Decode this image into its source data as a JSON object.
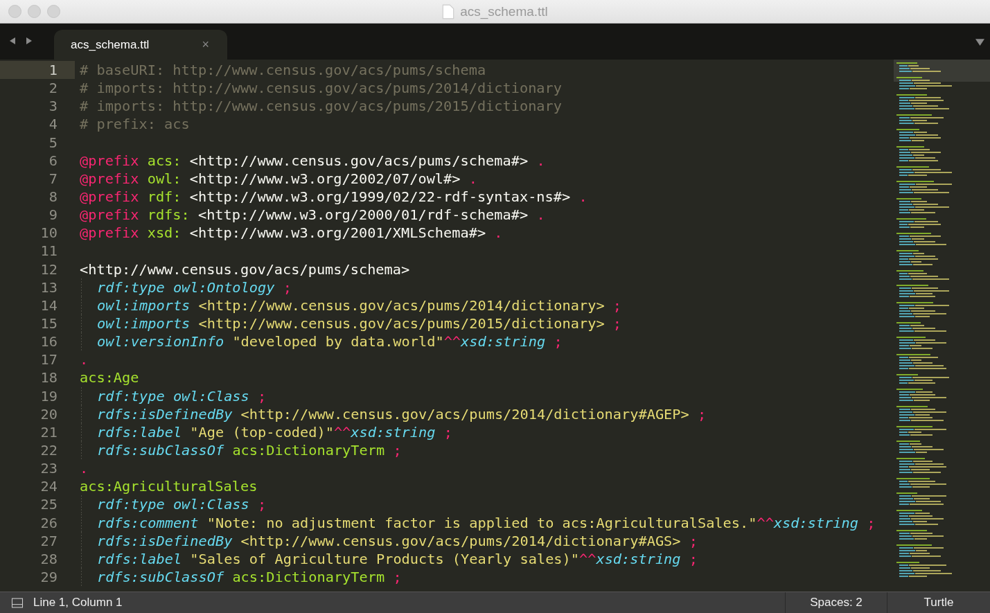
{
  "window": {
    "title": "acs_schema.ttl"
  },
  "tabs": [
    {
      "label": "acs_schema.ttl",
      "selected": true,
      "close": "×"
    }
  ],
  "lines": [
    {
      "number": "1",
      "current": true,
      "indented": false,
      "tokens": [
        {
          "kind": "comment",
          "text": "# baseURI: http://www.census.gov/acs/pums/schema"
        }
      ]
    },
    {
      "number": "2",
      "current": false,
      "indented": false,
      "tokens": [
        {
          "kind": "comment",
          "text": "# imports: http://www.census.gov/acs/pums/2014/dictionary"
        }
      ]
    },
    {
      "number": "3",
      "current": false,
      "indented": false,
      "tokens": [
        {
          "kind": "comment",
          "text": "# imports: http://www.census.gov/acs/pums/2015/dictionary"
        }
      ]
    },
    {
      "number": "4",
      "current": false,
      "indented": false,
      "tokens": [
        {
          "kind": "comment",
          "text": "# prefix: acs"
        }
      ]
    },
    {
      "number": "5",
      "current": false
    },
    {
      "number": "6",
      "current": false,
      "indented": false,
      "tokens": [
        {
          "kind": "keyword",
          "text": "@prefix "
        },
        {
          "kind": "name",
          "text": "acs: "
        },
        {
          "kind": "plain",
          "text": "<http://www.census.gov/acs/pums/schema#> "
        },
        {
          "kind": "keyword",
          "text": "."
        }
      ]
    },
    {
      "number": "7",
      "current": false,
      "indented": false,
      "tokens": [
        {
          "kind": "keyword",
          "text": "@prefix "
        },
        {
          "kind": "name",
          "text": "owl: "
        },
        {
          "kind": "plain",
          "text": "<http://www.w3.org/2002/07/owl#> "
        },
        {
          "kind": "keyword",
          "text": "."
        }
      ]
    },
    {
      "number": "8",
      "current": false,
      "indented": false,
      "tokens": [
        {
          "kind": "keyword",
          "text": "@prefix "
        },
        {
          "kind": "name",
          "text": "rdf: "
        },
        {
          "kind": "plain",
          "text": "<http://www.w3.org/1999/02/22-rdf-syntax-ns#> "
        },
        {
          "kind": "keyword",
          "text": "."
        }
      ]
    },
    {
      "number": "9",
      "current": false,
      "indented": false,
      "tokens": [
        {
          "kind": "keyword",
          "text": "@prefix "
        },
        {
          "kind": "name",
          "text": "rdfs: "
        },
        {
          "kind": "plain",
          "text": "<http://www.w3.org/2000/01/rdf-schema#> "
        },
        {
          "kind": "keyword",
          "text": "."
        }
      ]
    },
    {
      "number": "10",
      "current": false,
      "indented": false,
      "tokens": [
        {
          "kind": "keyword",
          "text": "@prefix "
        },
        {
          "kind": "name",
          "text": "xsd: "
        },
        {
          "kind": "plain",
          "text": "<http://www.w3.org/2001/XMLSchema#> "
        },
        {
          "kind": "keyword",
          "text": "."
        }
      ]
    },
    {
      "number": "11",
      "current": false
    },
    {
      "number": "12",
      "current": false,
      "indented": false,
      "tokens": [
        {
          "kind": "plain",
          "text": "<http://www.census.gov/acs/pums/schema>"
        }
      ]
    },
    {
      "number": "13",
      "current": false,
      "indented": true,
      "tokens": [
        {
          "kind": "type",
          "text": "rdf:type owl:Ontology "
        },
        {
          "kind": "keyword",
          "text": ";"
        }
      ]
    },
    {
      "number": "14",
      "current": false,
      "indented": true,
      "tokens": [
        {
          "kind": "type",
          "text": "owl:imports "
        },
        {
          "kind": "string",
          "text": "<http://www.census.gov/acs/pums/2014/dictionary> "
        },
        {
          "kind": "keyword",
          "text": ";"
        }
      ]
    },
    {
      "number": "15",
      "current": false,
      "indented": true,
      "tokens": [
        {
          "kind": "type",
          "text": "owl:imports "
        },
        {
          "kind": "string",
          "text": "<http://www.census.gov/acs/pums/2015/dictionary> "
        },
        {
          "kind": "keyword",
          "text": ";"
        }
      ]
    },
    {
      "number": "16",
      "current": false,
      "indented": true,
      "tokens": [
        {
          "kind": "type",
          "text": "owl:versionInfo "
        },
        {
          "kind": "string",
          "text": "\"developed by data.world\""
        },
        {
          "kind": "keyword",
          "text": "^^"
        },
        {
          "kind": "type",
          "text": "xsd:string "
        },
        {
          "kind": "keyword",
          "text": ";"
        }
      ]
    },
    {
      "number": "17",
      "current": false,
      "indented": false,
      "tokens": [
        {
          "kind": "keyword",
          "text": "."
        }
      ]
    },
    {
      "number": "18",
      "current": false,
      "indented": false,
      "tokens": [
        {
          "kind": "name",
          "text": "acs:Age"
        }
      ]
    },
    {
      "number": "19",
      "current": false,
      "indented": true,
      "tokens": [
        {
          "kind": "type",
          "text": "rdf:type owl:Class "
        },
        {
          "kind": "keyword",
          "text": ";"
        }
      ]
    },
    {
      "number": "20",
      "current": false,
      "indented": true,
      "tokens": [
        {
          "kind": "type",
          "text": "rdfs:isDefinedBy "
        },
        {
          "kind": "string",
          "text": "<http://www.census.gov/acs/pums/2014/dictionary#AGEP> "
        },
        {
          "kind": "keyword",
          "text": ";"
        }
      ]
    },
    {
      "number": "21",
      "current": false,
      "indented": true,
      "tokens": [
        {
          "kind": "type",
          "text": "rdfs:label "
        },
        {
          "kind": "string",
          "text": "\"Age (top-coded)\""
        },
        {
          "kind": "keyword",
          "text": "^^"
        },
        {
          "kind": "type",
          "text": "xsd:string "
        },
        {
          "kind": "keyword",
          "text": ";"
        }
      ]
    },
    {
      "number": "22",
      "current": false,
      "indented": true,
      "tokens": [
        {
          "kind": "type",
          "text": "rdfs:subClassOf "
        },
        {
          "kind": "name",
          "text": "acs:DictionaryTerm "
        },
        {
          "kind": "keyword",
          "text": ";"
        }
      ]
    },
    {
      "number": "23",
      "current": false,
      "indented": false,
      "tokens": [
        {
          "kind": "keyword",
          "text": "."
        }
      ]
    },
    {
      "number": "24",
      "current": false,
      "indented": false,
      "tokens": [
        {
          "kind": "name",
          "text": "acs:AgriculturalSales"
        }
      ]
    },
    {
      "number": "25",
      "current": false,
      "indented": true,
      "tokens": [
        {
          "kind": "type",
          "text": "rdf:type owl:Class "
        },
        {
          "kind": "keyword",
          "text": ";"
        }
      ]
    },
    {
      "number": "26",
      "current": false,
      "indented": true,
      "tokens": [
        {
          "kind": "type",
          "text": "rdfs:comment "
        },
        {
          "kind": "string",
          "text": "\"Note: no adjustment factor is applied to acs:AgriculturalSales.\""
        },
        {
          "kind": "keyword",
          "text": "^^"
        },
        {
          "kind": "type",
          "text": "xsd:string "
        },
        {
          "kind": "keyword",
          "text": ";"
        }
      ]
    },
    {
      "number": "27",
      "current": false,
      "indented": true,
      "tokens": [
        {
          "kind": "type",
          "text": "rdfs:isDefinedBy "
        },
        {
          "kind": "string",
          "text": "<http://www.census.gov/acs/pums/2014/dictionary#AGS> "
        },
        {
          "kind": "keyword",
          "text": ";"
        }
      ]
    },
    {
      "number": "28",
      "current": false,
      "indented": true,
      "tokens": [
        {
          "kind": "type",
          "text": "rdfs:label "
        },
        {
          "kind": "string",
          "text": "\"Sales of Agriculture Products (Yearly sales)\""
        },
        {
          "kind": "keyword",
          "text": "^^"
        },
        {
          "kind": "type",
          "text": "xsd:string "
        },
        {
          "kind": "keyword",
          "text": ";"
        }
      ]
    },
    {
      "number": "29",
      "current": false,
      "indented": true,
      "tokens": [
        {
          "kind": "type",
          "text": "rdfs:subClassOf "
        },
        {
          "kind": "name",
          "text": "acs:DictionaryTerm "
        },
        {
          "kind": "keyword",
          "text": ";"
        }
      ]
    }
  ],
  "status_bar": {
    "position": "Line 1, Column 1",
    "spaces": "Spaces: 2",
    "syntax": "Turtle"
  }
}
